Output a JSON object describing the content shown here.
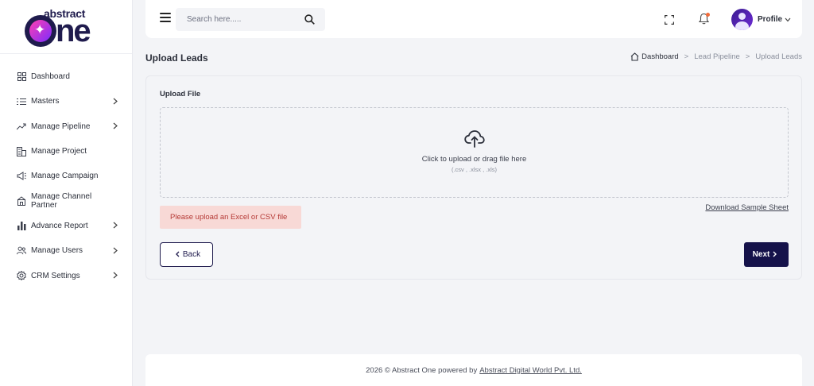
{
  "brand": {
    "top": "abstract",
    "bottom": "ne"
  },
  "sidebar": {
    "items": [
      {
        "label": "Dashboard",
        "icon": "grid-icon",
        "has_children": false
      },
      {
        "label": "Masters",
        "icon": "list-icon",
        "has_children": true
      },
      {
        "label": "Manage Pipeline",
        "icon": "pipeline-icon",
        "has_children": true
      },
      {
        "label": "Manage Project",
        "icon": "building-icon",
        "has_children": false
      },
      {
        "label": "Manage Campaign",
        "icon": "megaphone-icon",
        "has_children": false
      },
      {
        "label": "Manage Channel Partner",
        "icon": "handshake-icon",
        "has_children": false
      },
      {
        "label": "Advance Report",
        "icon": "bar-chart-icon",
        "has_children": true
      },
      {
        "label": "Manage Users",
        "icon": "users-icon",
        "has_children": true
      },
      {
        "label": "CRM Settings",
        "icon": "gear-icon",
        "has_children": true
      }
    ]
  },
  "header": {
    "search_placeholder": "Search here.....",
    "profile_label": "Profile"
  },
  "page": {
    "title": "Upload Leads",
    "breadcrumb": [
      "Dashboard",
      "Lead Pipeline",
      "Upload Leads"
    ]
  },
  "upload": {
    "label": "Upload File",
    "dropzone_title": "Click to upload or drag file here",
    "dropzone_formats": "(.csv , .xlsx , .xls)",
    "sample_link": "Download Sample Sheet",
    "error": "Please upload an Excel or CSV file",
    "back_label": "Back",
    "next_label": "Next"
  },
  "footer": {
    "text": "2026 © Abstract One powered by",
    "link": "Abstract Digital World Pvt. Ltd."
  },
  "colors": {
    "primary": "#15124a",
    "error_bg": "#f8d9d6",
    "error_text": "#b53a36",
    "notification": "#f26b3a"
  }
}
